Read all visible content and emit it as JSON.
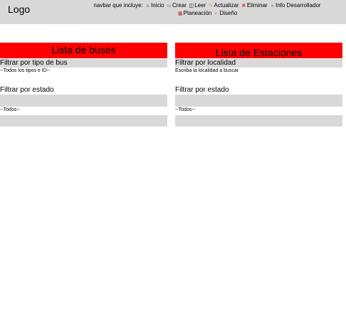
{
  "header": {
    "logo": "Logo",
    "nav_prefix": "navbar que incluye:",
    "items": [
      {
        "label": "Inicio",
        "icon": "house-icon"
      },
      {
        "label": "Crear",
        "icon": "computer-icon"
      },
      {
        "label": "Leer",
        "icon": "book-icon"
      },
      {
        "label": "Actualizar",
        "icon": "pencil-icon"
      },
      {
        "label": "Eliminar",
        "icon": "cross-icon"
      },
      {
        "label": "Info Desarrollador",
        "icon": "person-icon"
      },
      {
        "label": "Planeación",
        "icon": "calendar-icon"
      },
      {
        "label": "Diseño",
        "icon": "palette-icon"
      }
    ]
  },
  "buses": {
    "title": "Lista de buses",
    "filter_type_label": "Filtrar por tipo de bus",
    "filter_type_value": "--Todos los tipos e ID--",
    "filter_state_label": "Filtrar por estado",
    "filter_state_value": "--Todos--"
  },
  "stations": {
    "title": "Lista de Estaciones",
    "filter_location_label": "Filtrar por localidad",
    "filter_location_placeholder": "Escriba la localidad a buscar",
    "filter_state_label": "Filtrar por estado",
    "filter_state_value": "--Todos--"
  },
  "colors": {
    "accent_red": "#ff0000",
    "panel_gray": "#d9d9d9"
  }
}
